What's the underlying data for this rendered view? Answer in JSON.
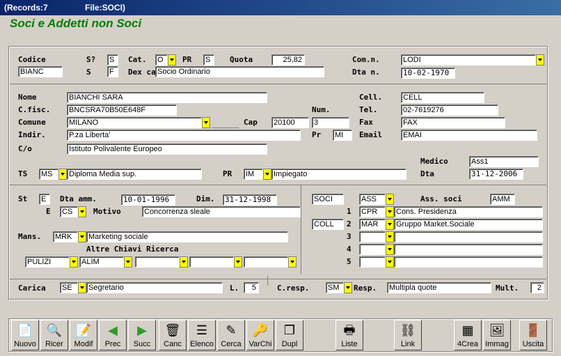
{
  "window": {
    "records": "(Records:7",
    "file": "File:SOCI)"
  },
  "form_title": "Soci e Addetti non Soci",
  "labels": {
    "codice": "Codice",
    "s_q": "S?",
    "cat": "Cat.",
    "pr": "PR",
    "quota": "Quota",
    "comn": "Com.n.",
    "s": "S",
    "dex": "Dex ca",
    "dtan": "Dta n.",
    "nome": "Nome",
    "cfisc": "C.fisc.",
    "comune": "Comune",
    "indir": "Indir.",
    "co": "C/o",
    "num": "Num.",
    "cap": "Cap",
    "pr2": "Pr",
    "cell": "Cell.",
    "tel": "Tel.",
    "fax": "Fax",
    "email": "Email",
    "medico": "Medico",
    "dta": "Dta",
    "ts": "TS",
    "pr3": "PR",
    "st": "St",
    "dtaamm": "Dta amm.",
    "dim": "Dim.",
    "e": "E",
    "motivo": "Motivo",
    "mans": "Mans.",
    "altre": "Altre Chiavi Ricerca",
    "asssoci": "Ass. soci",
    "n1": "1",
    "n2": "2",
    "n3": "3",
    "n4": "4",
    "n5": "5",
    "carica": "Carica",
    "l": "L.",
    "cresp": "C.resp.",
    "resp": "Resp.",
    "mult": "Mult."
  },
  "values": {
    "s_q": "S",
    "cat": "O",
    "pr": "S",
    "quota": "25,82",
    "comn": "LODI",
    "codice": "BIANC",
    "s": "F",
    "dex": "Socio Ordinario",
    "dtan": "10-02-1970",
    "nome": "BIANCHI SARA",
    "cfisc": "BNCSRA70B50E648F",
    "comune": "MILANO",
    "indir": "P.za Liberta'",
    "co": "Istituto Polivalente Europeo",
    "num": "3",
    "cap": "20100",
    "pr2": "MI",
    "cell": "CELL",
    "tel": "02-7619276",
    "fax": "FAX",
    "email": "EMAI",
    "medico": "Ass1",
    "dta": "31-12-2006",
    "ts_code": "MS",
    "ts_desc": "Diploma Media sup.",
    "pr3_code": "IM",
    "pr3_desc": "Impiegato",
    "st": "E",
    "dtaamm": "10-01-1996",
    "dim": "31-12-1998",
    "e_code": "CS",
    "motivo": "Concorrenza sleale",
    "mans_code": "MRK",
    "mans_desc": "Marketing sociale",
    "altre1": "PULIZI",
    "altre2": "ALIM",
    "altre3": "",
    "altre4": "",
    "altre5": "",
    "soci": "SOCI",
    "ass_code": "ASS",
    "amm": "AMM",
    "r1_code": "CPR",
    "r1_desc": "Cons. Presidenza",
    "coll": "COLL",
    "r2_code": "MAR",
    "r2_desc": "Gruppo Market.Sociale",
    "carica_code": "SE",
    "carica_desc": "Segretario",
    "l": "5",
    "cresp_code": "SM",
    "resp": "Multipla quote",
    "mult": "2"
  },
  "toolbar": [
    {
      "name": "nuovo-button",
      "icon": "new-doc-icon",
      "glyph": "📄",
      "label": "Nuovo"
    },
    {
      "name": "ricer-button",
      "icon": "search-icon",
      "glyph": "🔍",
      "label": "Ricer"
    },
    {
      "name": "modif-button",
      "icon": "edit-icon",
      "glyph": "📝",
      "label": "Modif"
    },
    {
      "name": "prec-button",
      "icon": "arrow-left-icon",
      "glyph": "◀",
      "label": "Prec"
    },
    {
      "name": "succ-button",
      "icon": "arrow-right-icon",
      "glyph": "▶",
      "label": "Succ"
    },
    {
      "name": "canc-button",
      "icon": "trash-icon",
      "glyph": "🗑",
      "label": "Canc"
    },
    {
      "name": "elenco-button",
      "icon": "list-icon",
      "glyph": "☰",
      "label": "Elenco"
    },
    {
      "name": "cerca-button",
      "icon": "find-icon",
      "glyph": "✎",
      "label": "Cerca"
    },
    {
      "name": "varchi-button",
      "icon": "keys-icon",
      "glyph": "🔑",
      "label": "VarChi"
    },
    {
      "name": "dupl-button",
      "icon": "duplicate-icon",
      "glyph": "❐",
      "label": "Dupl"
    },
    {
      "name": "liste-button",
      "icon": "printer-icon",
      "glyph": "🖶",
      "label": "Liste"
    },
    {
      "name": "link-button",
      "icon": "link-icon",
      "glyph": "⛓",
      "label": "Link"
    },
    {
      "name": "crea-button",
      "icon": "create-icon",
      "glyph": "▦",
      "label": "4Crea"
    },
    {
      "name": "immag-button",
      "icon": "image-icon",
      "glyph": "🖼",
      "label": "Immag"
    },
    {
      "name": "uscita-button",
      "icon": "exit-door-icon",
      "glyph": "🚪",
      "label": "Uscita"
    }
  ],
  "colors": {
    "title_bar": "#0a246a",
    "form_title": "#008000",
    "dropdown": "#ffff00",
    "background": "#d4d0c8"
  }
}
